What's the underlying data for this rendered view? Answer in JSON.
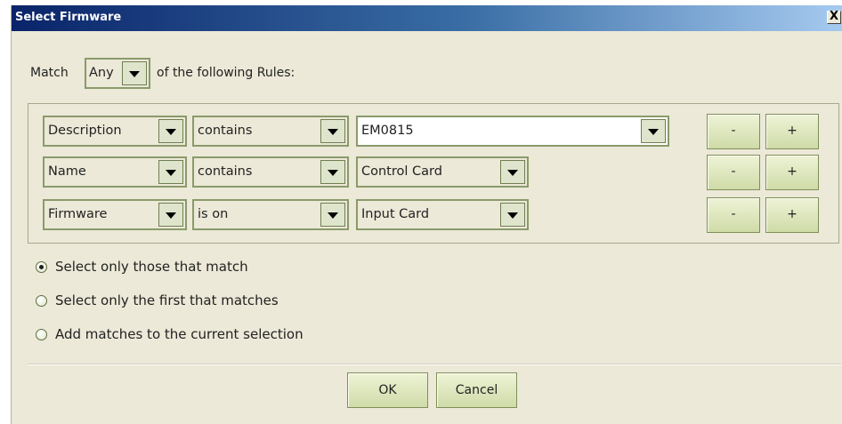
{
  "window": {
    "title": "Select Firmware",
    "close_glyph": "X"
  },
  "match": {
    "label_before": "Match",
    "mode_value": "Any",
    "label_after": "of the following Rules:"
  },
  "rules": [
    {
      "field": "Description",
      "operator": "contains",
      "value": "EM0815",
      "minus_label": "-",
      "plus_label": "+"
    },
    {
      "field": "Name",
      "operator": "contains",
      "value": "Control Card",
      "minus_label": "-",
      "plus_label": "+"
    },
    {
      "field": "Firmware",
      "operator": "is on",
      "value": "Input Card",
      "minus_label": "-",
      "plus_label": "+"
    }
  ],
  "options": [
    {
      "label": "Select only those that match",
      "selected": true
    },
    {
      "label": "Select only the first that matches",
      "selected": false
    },
    {
      "label": "Add matches to the current selection",
      "selected": false
    }
  ],
  "buttons": {
    "ok_label": "OK",
    "cancel_label": "Cancel"
  },
  "colors": {
    "dialog_background": "#ECE9D8",
    "title_bar_start": "#0a246a",
    "title_bar_end": "#a6caf0",
    "control_border": "#8a9a6a",
    "button_fill": "#cfdba8"
  },
  "icons": {
    "dropdown": "chevron-down-icon",
    "close": "close-icon",
    "radio": "radio-button-icon"
  }
}
